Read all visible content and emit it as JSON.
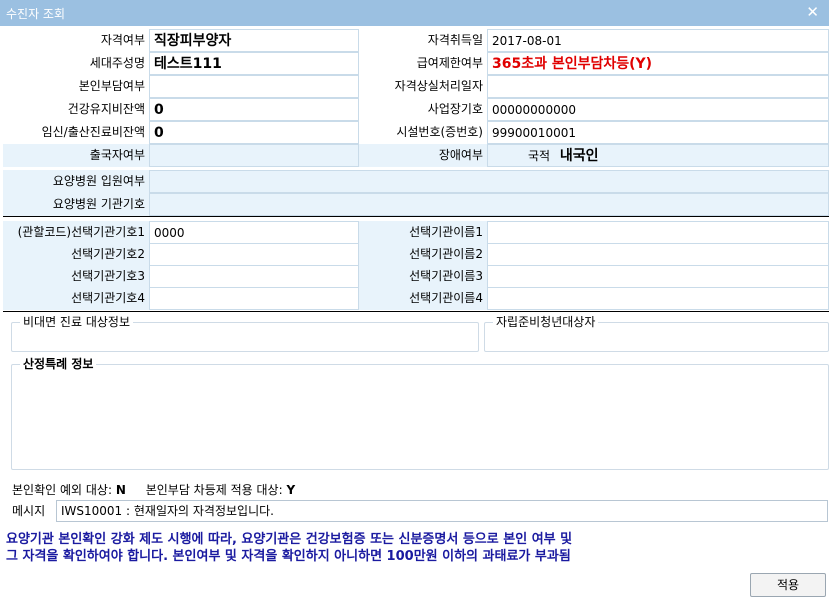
{
  "window": {
    "title": "수진자 조회",
    "close_glyph": "✕"
  },
  "info": {
    "r1": {
      "l1": "자격여부",
      "v1": "직장피부양자",
      "l2": "자격취득일",
      "v2": "2017-08-01"
    },
    "r2": {
      "l1": "세대주성명",
      "v1": "테스트111",
      "l2": "급여제한여부",
      "v2": "365초과 본인부담차등(Y)"
    },
    "r3": {
      "l1": "본인부담여부",
      "v1": "",
      "l2": "자격상실처리일자",
      "v2": ""
    },
    "r4": {
      "l1": "건강유지비잔액",
      "v1": "0",
      "l2": "사업장기호",
      "v2": "00000000000"
    },
    "r5": {
      "l1": "임신/출산진료비잔액",
      "v1": "0",
      "l2": "시설번호(증번호)",
      "v2": "99900010001"
    },
    "r6": {
      "l1": "출국자여부",
      "v1": "",
      "l2": "장애여부",
      "v2_label": "국적",
      "v2_value": "내국인"
    },
    "r7": {
      "l1": "요양병원 입원여부",
      "v1": ""
    },
    "r8": {
      "l1": "요양병원 기관기호",
      "v1": ""
    }
  },
  "selection": [
    {
      "l1": "(관할코드)선택기관기호1",
      "v1": "0000",
      "l2": "선택기관이름1",
      "v2": ""
    },
    {
      "l1": "선택기관기호2",
      "v1": "",
      "l2": "선택기관이름2",
      "v2": ""
    },
    {
      "l1": "선택기관기호3",
      "v1": "",
      "l2": "선택기관이름3",
      "v2": ""
    },
    {
      "l1": "선택기관기호4",
      "v1": "",
      "l2": "선택기관이름4",
      "v2": ""
    }
  ],
  "groups": {
    "nonface": "비대면 진료 대상정보",
    "youth": "자립준비청년대상자",
    "special": "산정특례 정보"
  },
  "status": {
    "verify_label": "본인확인 예외 대상:",
    "verify_value": "N",
    "copay_label": "본인부담 차등제 적용 대상:",
    "copay_value": "Y"
  },
  "message": {
    "label": "메시지",
    "value": "IWS10001 : 현재일자의 자격정보입니다."
  },
  "notice": {
    "line1": "요양기관 본인확인 강화 제도 시행에 따라, 요양기관은 건강보험증 또는 신분증명서 등으로 본인 여부 및",
    "line2": "그 자격을 확인하여야 합니다. 본인여부 및 자격을 확인하지 아니하면 100만원 이하의 과태료가 부과됨"
  },
  "apply_button": "적용"
}
